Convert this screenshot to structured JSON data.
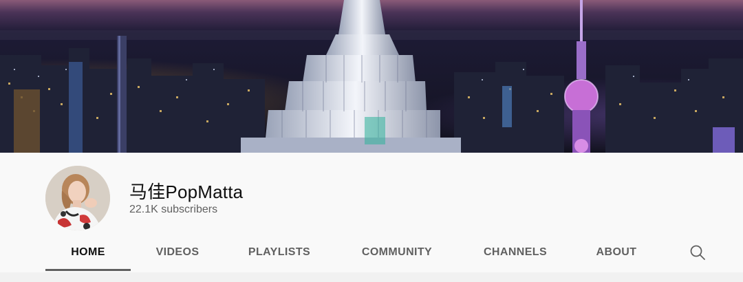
{
  "channel": {
    "name": "马佳PopMatta",
    "subscribers": "22.1K subscribers"
  },
  "tabs": [
    {
      "label": "HOME",
      "active": true
    },
    {
      "label": "VIDEOS",
      "active": false
    },
    {
      "label": "PLAYLISTS",
      "active": false
    },
    {
      "label": "COMMUNITY",
      "active": false
    },
    {
      "label": "CHANNELS",
      "active": false
    },
    {
      "label": "ABOUT",
      "active": false
    }
  ],
  "icons": {
    "search": "search-icon"
  },
  "colors": {
    "page_background": "#f9f9f9",
    "text_primary": "#0f0f0f",
    "text_secondary": "#606060"
  }
}
